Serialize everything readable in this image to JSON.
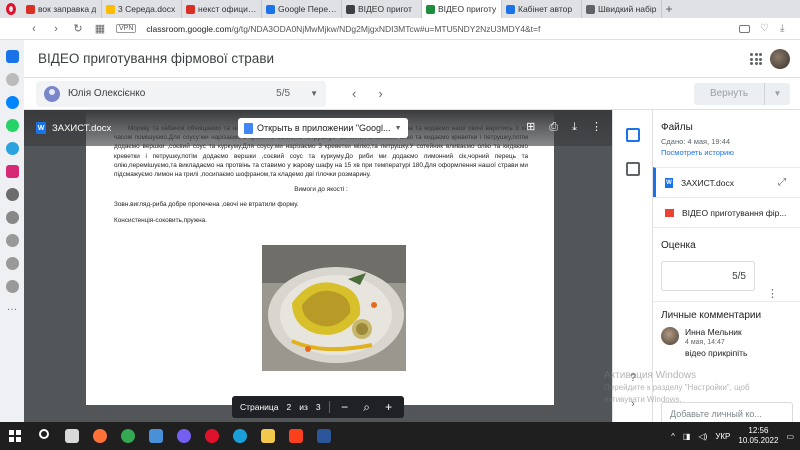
{
  "browser": {
    "tabs": [
      {
        "label": "вок заправка д",
        "color": "#d93025",
        "active": false
      },
      {
        "label": "3 Середа.docx",
        "color": "#fbbc04",
        "active": false
      },
      {
        "label": "некст официал",
        "color": "#d93025",
        "active": false
      },
      {
        "label": "Google Перевод",
        "color": "#1a73e8",
        "active": false
      },
      {
        "label": "ВІДЕО пригот",
        "color": "#3c4043",
        "active": false
      },
      {
        "label": "ВІДЕО приготу",
        "color": "#1e8e3e",
        "active": true
      },
      {
        "label": "Кабінет автор",
        "color": "#1a73e8",
        "active": false
      },
      {
        "label": "Швидкий набір",
        "color": "#5f6368",
        "active": false
      }
    ],
    "vpn": "VPN",
    "url_host": "classroom.google.com",
    "url_path": "/g/tg/NDA3ODA0NjMwMjkw/NDg2MjgxNDI3MTcw#u=MTU5NDY2NzU3MDY4&t=f"
  },
  "classroom": {
    "title": "ВІДЕО приготування фірмової страви",
    "student_name": "Юлія Олексієнко",
    "student_grade": "5/5",
    "return_label": "Вернуть"
  },
  "viewer": {
    "doc_name": "ЗАХИСТ.docx",
    "open_with": "Открыть в приложении \"Googl...",
    "page_label": "Страница",
    "page_current": "2",
    "page_of": "из",
    "page_total": "3",
    "body_text": "Моркву та кабачок обчищаємо та нарізаємо соломкою,додаємо трохи солі,перець,сік лимона та кидаємо нашi овочі варитись 3 хв часом помішуємо.Для соусу:ми нарізаємо 3 креветки мілко,та петрушку.У сотейник вливаємо олію та кидаємо креветки і петрушку,потім додаємо вершки ,соєвий соус та куркуму.Для соусу:ми нарізаємо 3 креветки мілко,та петрушку.У сотейник вливаємо олію та кидаємо креветки і петрушку,потім додаємо вершки ,соєвий соус та куркуму.До риби ми додаємо лимонний сік,чорний перець та олію,перемішуємо,та викладаємо на протвінь та ставимо у жарову шафу на 15 хв при температурі 180.Для оформлення нашої страви ми підсмажуємо лимон на грилі ,посипаємо шофраном,та кладемо дві гілочки розмарину.",
    "req_title": "Вимоги до якості :",
    "req_1": "Зовн.вигляд-риба добре пропечена ,овочі не втратили форму.",
    "req_2": "Консистенція-соковить,пружна."
  },
  "details": {
    "files_title": "Файлы",
    "files_meta": "Сдано: 4 мая, 19:44",
    "history_link": "Посмотреть историю",
    "files": [
      {
        "name": "ЗАХИСТ.docx",
        "kind": "word"
      },
      {
        "name": "ВІДЕО приготування фір...",
        "kind": "video"
      }
    ],
    "grade_title": "Оценка",
    "grade_value": "5/5",
    "comments_title": "Личные комментарии",
    "comment_author": "Инна Мельник",
    "comment_time": "4 мая, 14:47",
    "comment_text": "відео прикріпіть",
    "add_comment_placeholder": "Добавьте личный ко..."
  },
  "watermark": {
    "line1": "Активация Windows",
    "line2": "Перейдите к разделу \"Настройки\", щоб",
    "line3": "активувати Windows."
  },
  "taskbar": {
    "icons": [
      {
        "name": "search-icon",
        "color": "#ffffff"
      },
      {
        "name": "task-view-icon",
        "color": "#d9d9d9"
      },
      {
        "name": "firefox-icon",
        "color": "#ff7139"
      },
      {
        "name": "chrome-icon",
        "color": "#34a853"
      },
      {
        "name": "photos-icon",
        "color": "#4a90d9"
      },
      {
        "name": "viber-icon",
        "color": "#7360f2"
      },
      {
        "name": "opera-icon",
        "color": "#e0112b"
      },
      {
        "name": "edge-icon",
        "color": "#1aa0d8"
      },
      {
        "name": "file-explorer-icon",
        "color": "#f2c94c"
      },
      {
        "name": "yandex-icon",
        "color": "#fc3f1d"
      },
      {
        "name": "word-icon",
        "color": "#2b579a"
      }
    ],
    "lang": "УКР",
    "time": "12:56",
    "date": "10.05.2022"
  }
}
